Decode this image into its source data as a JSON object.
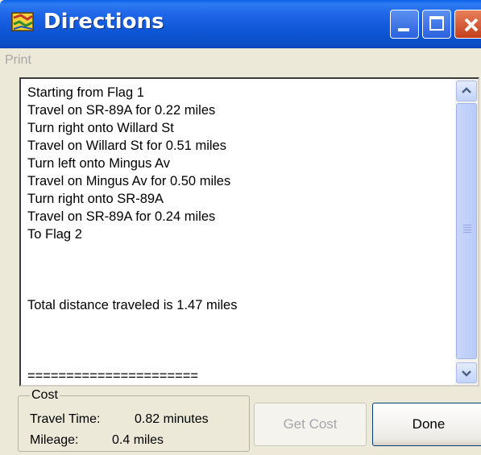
{
  "window": {
    "title": "Directions",
    "icon": "map-app-icon",
    "controls": [
      "minimize",
      "maximize",
      "close"
    ]
  },
  "menu": {
    "print_label": "Print"
  },
  "directions": {
    "lines": [
      "Starting from Flag 1",
      "Travel on SR-89A for 0.22 miles",
      "Turn right onto Willard St",
      "Travel on Willard St for 0.51 miles",
      "Turn left onto Mingus Av",
      "Travel on Mingus Av for 0.50 miles",
      "Turn right onto SR-89A",
      "Travel on SR-89A for 0.24 miles",
      "To Flag 2",
      "",
      "",
      "",
      "Total distance traveled is 1.47 miles",
      "",
      "",
      "",
      "======================"
    ]
  },
  "cost": {
    "legend": "Cost",
    "travel_time_label": "Travel Time:",
    "travel_time_value": "0.82 minutes",
    "mileage_label": "Mileage:",
    "mileage_value": "0.4 miles"
  },
  "buttons": {
    "get_cost": "Get Cost",
    "done": "Done"
  },
  "colors": {
    "titlebar": "#0a5fe6",
    "window_bg": "#ece9d8",
    "disabled_text": "#a7a6aa"
  }
}
